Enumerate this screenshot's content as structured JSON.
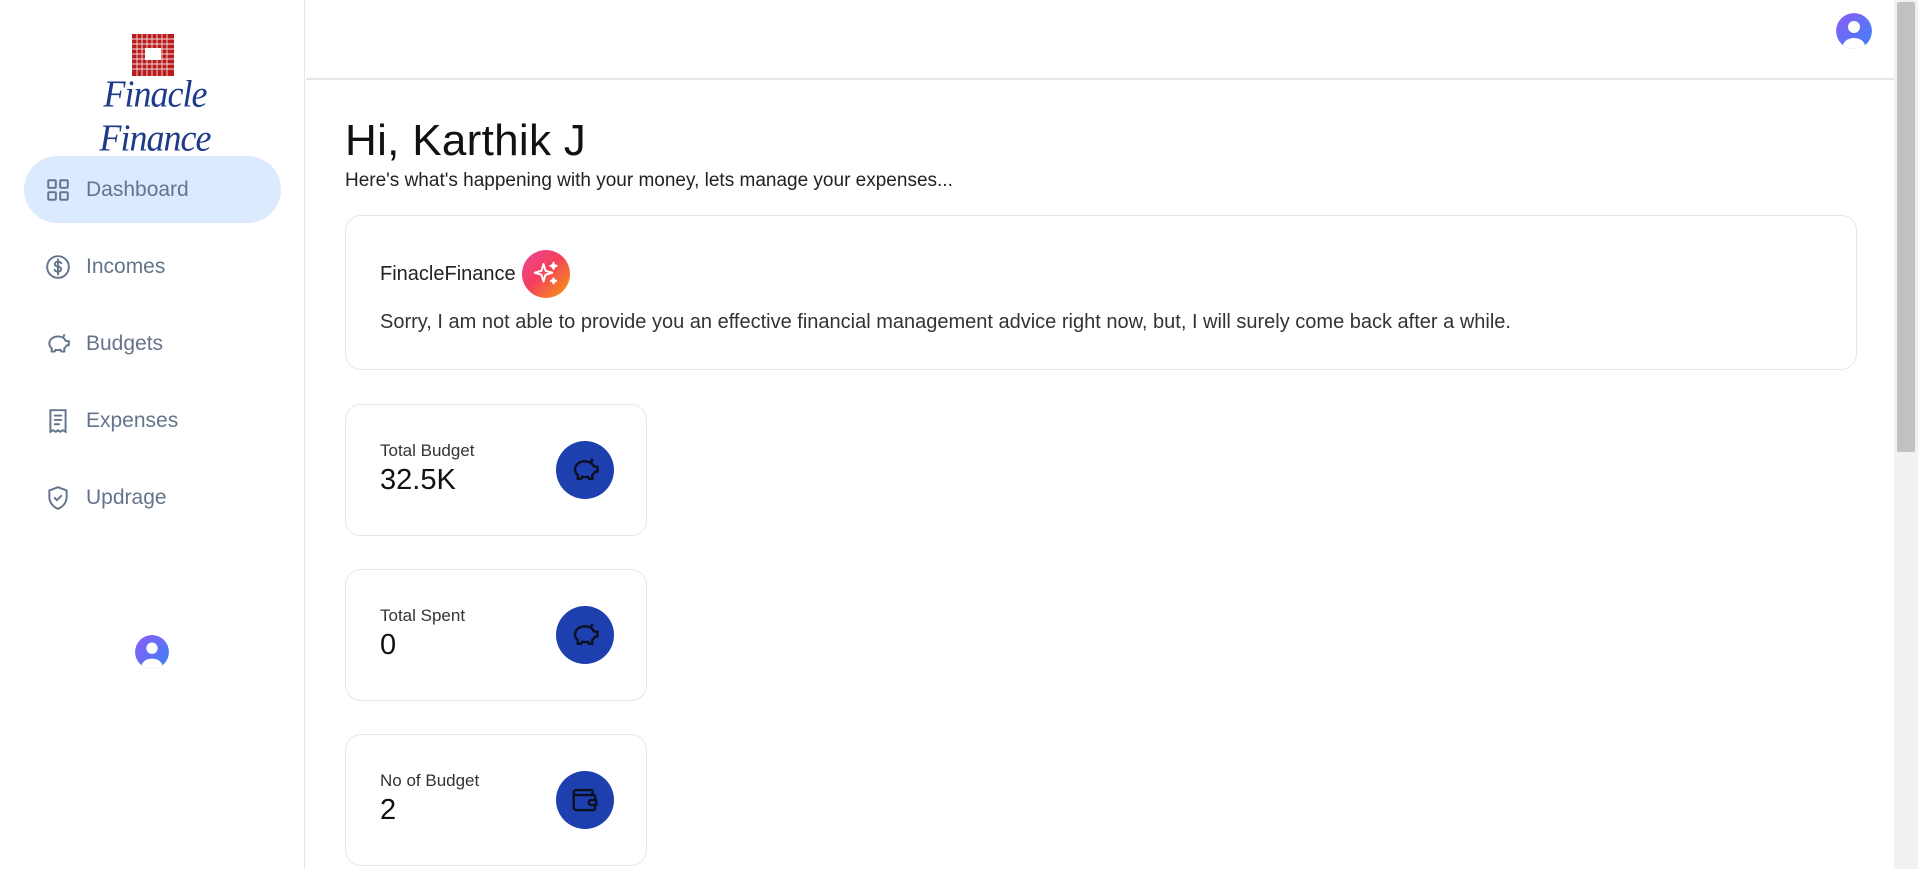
{
  "brand": {
    "name": "Finacle Finance",
    "color": "#1e3a8a",
    "mark_color": "#b91c1c"
  },
  "sidebar": {
    "items": [
      {
        "label": "Dashboard",
        "icon": "grid-icon",
        "active": true
      },
      {
        "label": "Incomes",
        "icon": "dollar-circle-icon",
        "active": false
      },
      {
        "label": "Budgets",
        "icon": "piggy-bank-icon",
        "active": false
      },
      {
        "label": "Expenses",
        "icon": "receipt-icon",
        "active": false
      },
      {
        "label": "Updrage",
        "icon": "shield-check-icon",
        "active": false
      }
    ]
  },
  "main": {
    "greeting": "Hi, Karthik J",
    "subtitle": "Here's what's happening with your money, lets manage your expenses..."
  },
  "ai_card": {
    "title": "FinacleFinance",
    "icon": "sparkles-icon",
    "message": "Sorry, I am not able to provide you an effective financial management advice right now, but, I will surely come back after a while."
  },
  "stats": [
    {
      "label": "Total Budget",
      "value": "32.5K",
      "icon": "piggy-bank-icon"
    },
    {
      "label": "Total Spent",
      "value": "0",
      "icon": "piggy-bank-icon"
    },
    {
      "label": "No of Budget",
      "value": "2",
      "icon": "wallet-icon"
    }
  ],
  "colors": {
    "accent": "#1e40af",
    "active_nav": "#dbeafe",
    "avatar": "#6366f1"
  }
}
